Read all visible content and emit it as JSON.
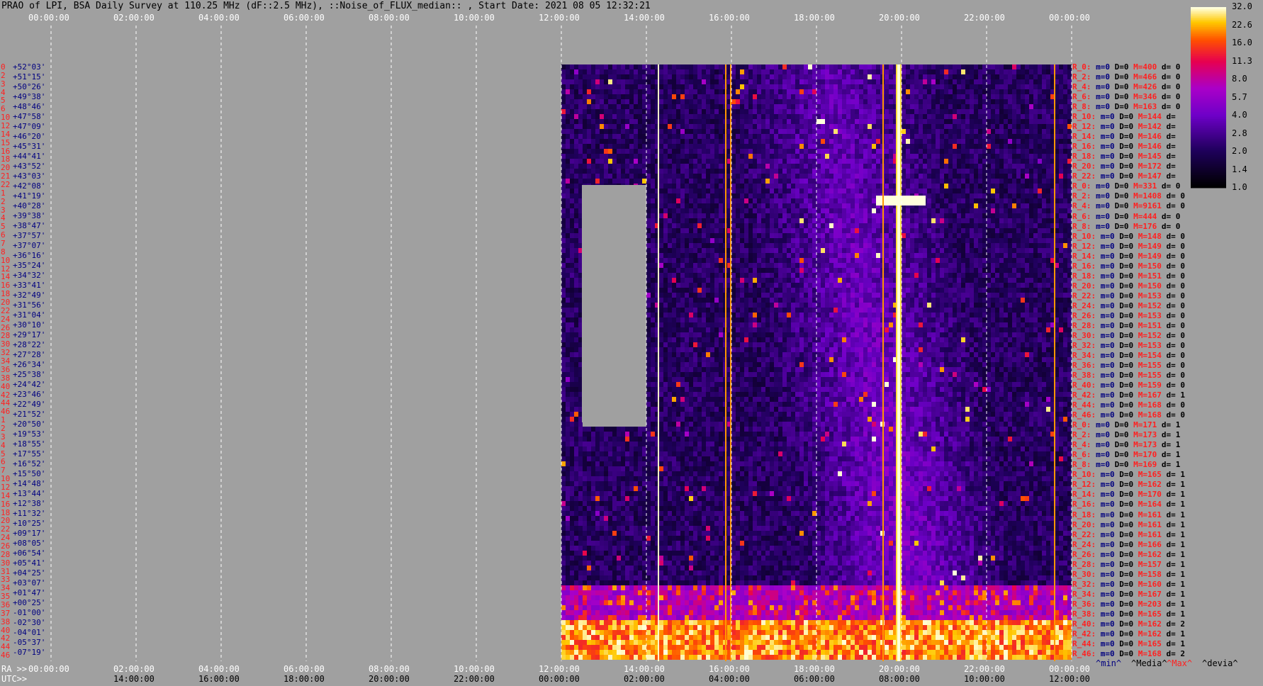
{
  "title": "PRAO of LPI, BSA Daily Survey at 110.25 MHz (dF::2.5 MHz), ::Noise_of_FLUX_median:: , Start Date: 2021 08 05 12:32:21",
  "chart_data": {
    "type": "heatmap",
    "colorbar_ticks": [
      "32.0",
      "22.6",
      "16.0",
      "11.3",
      "8.0",
      "5.7",
      "4.0",
      "2.8",
      "2.0",
      "1.4",
      "1.0"
    ],
    "top_axis_ticks": [
      "00:00:00",
      "02:00:00",
      "04:00:00",
      "06:00:00",
      "08:00:00",
      "10:00:00",
      "12:00:00",
      "14:00:00",
      "16:00:00",
      "18:00:00",
      "20:00:00",
      "22:00:00",
      "00:00:00"
    ],
    "ra_axis": {
      "label": "RA >>",
      "ticks": [
        "00:00:00",
        "02:00:00",
        "04:00:00",
        "06:00:00",
        "08:00:00",
        "10:00:00",
        "12:00:00",
        "14:00:00",
        "16:00:00",
        "18:00:00",
        "20:00:00",
        "22:00:00",
        "00:00:00"
      ]
    },
    "utc_axis": {
      "label": "UTC>>",
      "ticks": [
        "14:00:00",
        "16:00:00",
        "18:00:00",
        "20:00:00",
        "22:00:00",
        "00:00:00",
        "02:00:00",
        "04:00:00",
        "06:00:00",
        "08:00:00",
        "10:00:00",
        "12:00:00"
      ]
    },
    "declinations": [
      "+52°03'",
      "+51°15'",
      "+50°26'",
      "+49°38'",
      "+48°46'",
      "+47°58'",
      "+47°09'",
      "+46°20'",
      "+45°31'",
      "+44°41'",
      "+43°52'",
      "+43°03'",
      "+42°08'",
      "+41°19'",
      "+40°28'",
      "+39°38'",
      "+38°47'",
      "+37°57'",
      "+37°07'",
      "+36°16'",
      "+35°24'",
      "+34°32'",
      "+33°41'",
      "+32°49'",
      "+31°56'",
      "+31°04'",
      "+30°10'",
      "+29°17'",
      "+28°22'",
      "+27°28'",
      "+26°34'",
      "+25°38'",
      "+24°42'",
      "+23°46'",
      "+22°49'",
      "+21°52'",
      "+20°50'",
      "+19°53'",
      "+18°55'",
      "+17°55'",
      "+16°52'",
      "+15°50'",
      "+14°48'",
      "+13°44'",
      "+12°38'",
      "+11°32'",
      "+10°25'",
      "+09°17'",
      "+08°05'",
      "+06°54'",
      "+05°41'",
      "+04°25'",
      "+03°07'",
      "+01°47'",
      "+00°25'",
      "-01°00'",
      "-02°30'",
      "-04°01'",
      "-05°37'",
      "-07°19'"
    ],
    "row_indices": [
      "0",
      "2",
      "3",
      "4",
      "5",
      "6",
      "10",
      "12",
      "14",
      "15",
      "16",
      "18",
      "20",
      "21",
      "22",
      "1",
      "2",
      "3",
      "4",
      "5",
      "6",
      "7",
      "8",
      "10",
      "12",
      "14",
      "16",
      "18",
      "20",
      "22",
      "24",
      "26",
      "28",
      "30",
      "32",
      "34",
      "36",
      "38",
      "40",
      "42",
      "44",
      "46",
      "1",
      "2",
      "3",
      "4",
      "5",
      "6",
      "7",
      "10",
      "12",
      "14",
      "16",
      "18",
      "20",
      "22",
      "24",
      "26",
      "28",
      "30",
      "31",
      "33",
      "34",
      "35",
      "36",
      "37",
      "38",
      "40",
      "42",
      "44",
      "46"
    ],
    "stats_rows": [
      {
        "r": "R_0:",
        "m": "m=0",
        "D": "D=0",
        "M": "M=400",
        "d": "d= 0"
      },
      {
        "r": "R_2:",
        "m": "m=0",
        "D": "D=0",
        "M": "M=466",
        "d": "d= 0"
      },
      {
        "r": "R_4:",
        "m": "m=0",
        "D": "D=0",
        "M": "M=426",
        "d": "d= 0"
      },
      {
        "r": "R_6:",
        "m": "m=0",
        "D": "D=0",
        "M": "M=346",
        "d": "d= 0"
      },
      {
        "r": "R_8:",
        "m": "m=0",
        "D": "D=0",
        "M": "M=163",
        "d": "d= 0"
      },
      {
        "r": "R_10:",
        "m": "m=0",
        "D": "D=0",
        "M": "M=144",
        "d": "d="
      },
      {
        "r": "R_12:",
        "m": "m=0",
        "D": "D=0",
        "M": "M=142",
        "d": "d="
      },
      {
        "r": "R_14:",
        "m": "m=0",
        "D": "D=0",
        "M": "M=146",
        "d": "d="
      },
      {
        "r": "R_16:",
        "m": "m=0",
        "D": "D=0",
        "M": "M=146",
        "d": "d="
      },
      {
        "r": "R_18:",
        "m": "m=0",
        "D": "D=0",
        "M": "M=145",
        "d": "d="
      },
      {
        "r": "R_20:",
        "m": "m=0",
        "D": "D=0",
        "M": "M=172",
        "d": "d="
      },
      {
        "r": "R_22:",
        "m": "m=0",
        "D": "D=0",
        "M": "M=147",
        "d": "d="
      },
      {
        "r": "R_0:",
        "m": "m=0",
        "D": "D=0",
        "M": "M=331",
        "d": "d= 0"
      },
      {
        "r": "R_2:",
        "m": "m=0",
        "D": "D=0",
        "M": "M=1408",
        "d": "d= 0"
      },
      {
        "r": "R_4:",
        "m": "m=0",
        "D": "D=0",
        "M": "M=9161",
        "d": "d= 0"
      },
      {
        "r": "R_6:",
        "m": "m=0",
        "D": "D=0",
        "M": "M=444",
        "d": "d= 0"
      },
      {
        "r": "R_8:",
        "m": "m=0",
        "D": "D=0",
        "M": "M=176",
        "d": "d= 0"
      },
      {
        "r": "R_10:",
        "m": "m=0",
        "D": "D=0",
        "M": "M=148",
        "d": "d= 0"
      },
      {
        "r": "R_12:",
        "m": "m=0",
        "D": "D=0",
        "M": "M=149",
        "d": "d= 0"
      },
      {
        "r": "R_14:",
        "m": "m=0",
        "D": "D=0",
        "M": "M=149",
        "d": "d= 0"
      },
      {
        "r": "R_16:",
        "m": "m=0",
        "D": "D=0",
        "M": "M=150",
        "d": "d= 0"
      },
      {
        "r": "R_18:",
        "m": "m=0",
        "D": "D=0",
        "M": "M=151",
        "d": "d= 0"
      },
      {
        "r": "R_20:",
        "m": "m=0",
        "D": "D=0",
        "M": "M=150",
        "d": "d= 0"
      },
      {
        "r": "R_22:",
        "m": "m=0",
        "D": "D=0",
        "M": "M=153",
        "d": "d= 0"
      },
      {
        "r": "R_24:",
        "m": "m=0",
        "D": "D=0",
        "M": "M=152",
        "d": "d= 0"
      },
      {
        "r": "R_26:",
        "m": "m=0",
        "D": "D=0",
        "M": "M=153",
        "d": "d= 0"
      },
      {
        "r": "R_28:",
        "m": "m=0",
        "D": "D=0",
        "M": "M=151",
        "d": "d= 0"
      },
      {
        "r": "R_30:",
        "m": "m=0",
        "D": "D=0",
        "M": "M=152",
        "d": "d= 0"
      },
      {
        "r": "R_32:",
        "m": "m=0",
        "D": "D=0",
        "M": "M=153",
        "d": "d= 0"
      },
      {
        "r": "R_34:",
        "m": "m=0",
        "D": "D=0",
        "M": "M=154",
        "d": "d= 0"
      },
      {
        "r": "R_36:",
        "m": "m=0",
        "D": "D=0",
        "M": "M=155",
        "d": "d= 0"
      },
      {
        "r": "R_38:",
        "m": "m=0",
        "D": "D=0",
        "M": "M=155",
        "d": "d= 0"
      },
      {
        "r": "R_40:",
        "m": "m=0",
        "D": "D=0",
        "M": "M=159",
        "d": "d= 0"
      },
      {
        "r": "R_42:",
        "m": "m=0",
        "D": "D=0",
        "M": "M=167",
        "d": "d= 1"
      },
      {
        "r": "R_44:",
        "m": "m=0",
        "D": "D=0",
        "M": "M=168",
        "d": "d= 0"
      },
      {
        "r": "R_46:",
        "m": "m=0",
        "D": "D=0",
        "M": "M=168",
        "d": "d= 0"
      },
      {
        "r": "R_0:",
        "m": "m=0",
        "D": "D=0",
        "M": "M=171",
        "d": "d= 1"
      },
      {
        "r": "R_2:",
        "m": "m=0",
        "D": "D=0",
        "M": "M=173",
        "d": "d= 1"
      },
      {
        "r": "R_4:",
        "m": "m=0",
        "D": "D=0",
        "M": "M=173",
        "d": "d= 1"
      },
      {
        "r": "R_6:",
        "m": "m=0",
        "D": "D=0",
        "M": "M=170",
        "d": "d= 1"
      },
      {
        "r": "R_8:",
        "m": "m=0",
        "D": "D=0",
        "M": "M=169",
        "d": "d= 1"
      },
      {
        "r": "R_10:",
        "m": "m=0",
        "D": "D=0",
        "M": "M=165",
        "d": "d= 1"
      },
      {
        "r": "R_12:",
        "m": "m=0",
        "D": "D=0",
        "M": "M=162",
        "d": "d= 1"
      },
      {
        "r": "R_14:",
        "m": "m=0",
        "D": "D=0",
        "M": "M=170",
        "d": "d= 1"
      },
      {
        "r": "R_16:",
        "m": "m=0",
        "D": "D=0",
        "M": "M=164",
        "d": "d= 1"
      },
      {
        "r": "R_18:",
        "m": "m=0",
        "D": "D=0",
        "M": "M=161",
        "d": "d= 1"
      },
      {
        "r": "R_20:",
        "m": "m=0",
        "D": "D=0",
        "M": "M=161",
        "d": "d= 1"
      },
      {
        "r": "R_22:",
        "m": "m=0",
        "D": "D=0",
        "M": "M=161",
        "d": "d= 1"
      },
      {
        "r": "R_24:",
        "m": "m=0",
        "D": "D=0",
        "M": "M=166",
        "d": "d= 1"
      },
      {
        "r": "R_26:",
        "m": "m=0",
        "D": "D=0",
        "M": "M=162",
        "d": "d= 1"
      },
      {
        "r": "R_28:",
        "m": "m=0",
        "D": "D=0",
        "M": "M=157",
        "d": "d= 1"
      },
      {
        "r": "R_30:",
        "m": "m=0",
        "D": "D=0",
        "M": "M=158",
        "d": "d= 1"
      },
      {
        "r": "R_32:",
        "m": "m=0",
        "D": "D=0",
        "M": "M=160",
        "d": "d= 1"
      },
      {
        "r": "R_34:",
        "m": "m=0",
        "D": "D=0",
        "M": "M=167",
        "d": "d= 1"
      },
      {
        "r": "R_36:",
        "m": "m=0",
        "D": "D=0",
        "M": "M=203",
        "d": "d= 1"
      },
      {
        "r": "R_38:",
        "m": "m=0",
        "D": "D=0",
        "M": "M=165",
        "d": "d= 1"
      },
      {
        "r": "R_40:",
        "m": "m=0",
        "D": "D=0",
        "M": "M=162",
        "d": "d= 2"
      },
      {
        "r": "R_42:",
        "m": "m=0",
        "D": "D=0",
        "M": "M=162",
        "d": "d= 1"
      },
      {
        "r": "R_44:",
        "m": "m=0",
        "D": "D=0",
        "M": "M=165",
        "d": "d= 1"
      },
      {
        "r": "R_46:",
        "m": "m=0",
        "D": "D=0",
        "M": "M=168",
        "d": "d= 2"
      }
    ],
    "stats_legend": [
      "^min^",
      "^Media^",
      "^Max^",
      "^devia^"
    ],
    "colors": {
      "label_red": "#ff2020",
      "label_blue": "#000080",
      "background": "#a0a0a0",
      "gap": "#a0a0a0"
    }
  }
}
